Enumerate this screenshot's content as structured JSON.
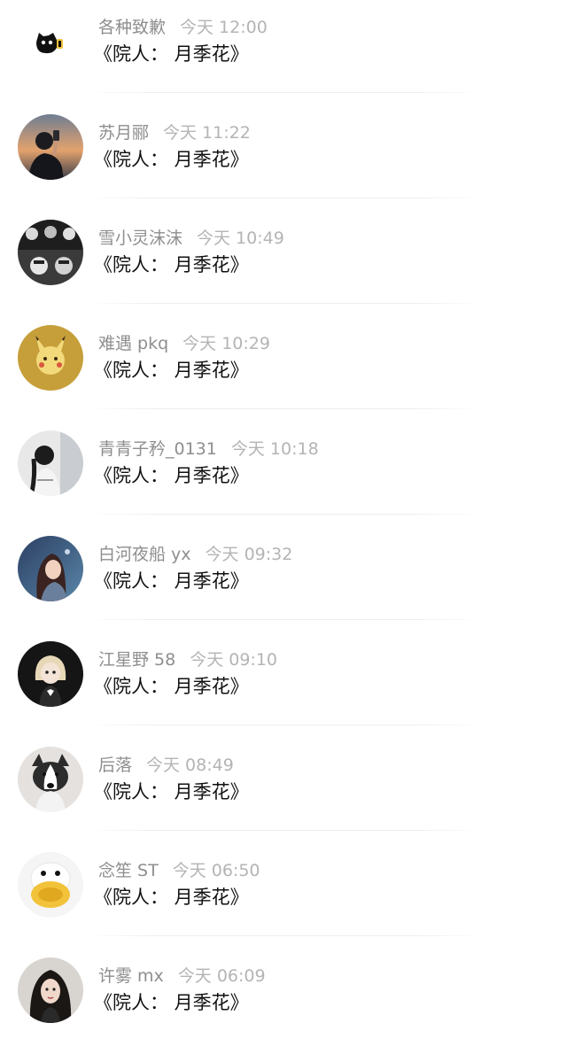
{
  "comments": [
    {
      "user": "各种致歉",
      "time": "今天 12:00",
      "text": "《院人：  月季花》",
      "avatar_icon": "cartoon-cat-icon",
      "avatar_color": "#111111"
    },
    {
      "user": "苏月郦",
      "time": "今天 11:22",
      "text": "《院人：  月季花》",
      "avatar_icon": "person-photo-sunset",
      "avatar_color": "#c98a5c"
    },
    {
      "user": "雪小灵沫沫",
      "time": "今天 10:49",
      "text": "《院人：  月季花》",
      "avatar_icon": "monochrome-group-photo",
      "avatar_color": "#2a2a2a"
    },
    {
      "user": "难遇 pkq",
      "time": "今天 10:29",
      "text": "《院人：  月季花》",
      "avatar_icon": "pikachu-icon",
      "avatar_color": "#c7a23c"
    },
    {
      "user": "青青子矜_0131",
      "time": "今天 10:18",
      "text": "《院人：  月季花》",
      "avatar_icon": "person-photo-dark",
      "avatar_color": "#3a3a3a"
    },
    {
      "user": "白河夜船 yx",
      "time": "今天 09:32",
      "text": "《院人：  月季花》",
      "avatar_icon": "anime-girl-icon",
      "avatar_color": "#2e4a6e"
    },
    {
      "user": "江星野 58",
      "time": "今天 09:10",
      "text": "《院人：  月季花》",
      "avatar_icon": "anime-doll-icon",
      "avatar_color": "#1b1b1b"
    },
    {
      "user": "后落",
      "time": "今天 08:49",
      "text": "《院人：  月季花》",
      "avatar_icon": "husky-puppy-icon",
      "avatar_color": "#d9d4cf"
    },
    {
      "user": "念笙 ST",
      "time": "今天 06:50",
      "text": "《院人：  月季花》",
      "avatar_icon": "duck-icon",
      "avatar_color": "#f2c23a"
    },
    {
      "user": "许雾 mx",
      "time": "今天 06:09",
      "text": "《院人：  月季花》",
      "avatar_icon": "person-photo-girl",
      "avatar_color": "#2b2420"
    }
  ]
}
